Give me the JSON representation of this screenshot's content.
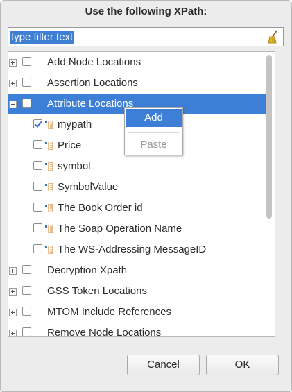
{
  "dialog": {
    "title": "Use the following XPath:",
    "filter": {
      "value": "type filter text",
      "icon": "broom-icon"
    }
  },
  "tree": {
    "items": [
      {
        "label": "Add Node Locations",
        "expanded": false,
        "checked": false
      },
      {
        "label": "Assertion Locations",
        "expanded": false,
        "checked": false
      },
      {
        "label": "Attribute Locations",
        "expanded": true,
        "checked": false,
        "selected": true
      },
      {
        "label": "mypath",
        "checked": true,
        "icon": "xpath-icon"
      },
      {
        "label": "Price",
        "checked": false,
        "icon": "xpath-icon"
      },
      {
        "label": "symbol",
        "checked": false,
        "icon": "xpath-icon"
      },
      {
        "label": "SymbolValue",
        "checked": false,
        "icon": "xpath-icon"
      },
      {
        "label": "The Book Order id",
        "checked": false,
        "icon": "xpath-icon"
      },
      {
        "label": "The Soap Operation Name",
        "checked": false,
        "icon": "xpath-icon"
      },
      {
        "label": "The WS-Addressing MessageID",
        "checked": false,
        "icon": "xpath-icon"
      },
      {
        "label": "Decryption Xpath",
        "expanded": false,
        "checked": false
      },
      {
        "label": "GSS Token Locations",
        "expanded": false,
        "checked": false
      },
      {
        "label": "MTOM Include References",
        "expanded": false,
        "checked": false
      },
      {
        "label": "Remove Node Locations",
        "expanded": false,
        "checked": false
      }
    ]
  },
  "context_menu": {
    "items": [
      {
        "label": "Add",
        "enabled": true,
        "highlighted": true
      },
      {
        "label": "Paste",
        "enabled": false
      }
    ]
  },
  "buttons": {
    "cancel": "Cancel",
    "ok": "OK"
  },
  "colors": {
    "selection": "#3d7fd6",
    "dialog_bg": "#ececec",
    "checkmark": "#2b6fd0"
  }
}
